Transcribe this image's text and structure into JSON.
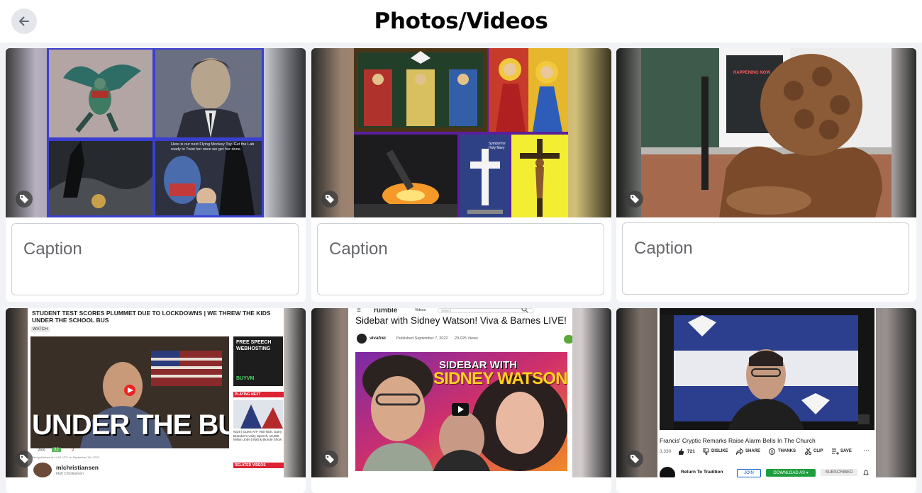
{
  "header": {
    "title": "Photos/Videos",
    "back_icon": "arrow-left-icon"
  },
  "captions": {
    "placeholder": "Caption"
  },
  "tag_icon": "tag-icon",
  "cards": {
    "card4": {
      "headline": "STUDENT TEST SCORES PLUMMET DUE TO LOCKDOWNS | WE THREW THE KIDS UNDER THE SCHOOL BUS",
      "watch": "WATCH",
      "overlay_text": "UNDER THE BUS",
      "ad_title": "FREE SPEECH WEBHOSTING",
      "ad_brand": "BUYVM",
      "playing_next": "PLAYING NEXT",
      "related": "RELATED VIDEOS",
      "side_text": "#226 | Guest ATF Visit Nick, Garry Brandon's Unity Speech, 10,000 Million Jobs | Matt & Blonde Show",
      "channel": "mlchristiansen",
      "channel_sub": "Matt Christiansen",
      "views": "293",
      "likes": "32",
      "dislikes": "2",
      "published": "First published at 14:51 UTC on September 7th, 2022."
    },
    "card5": {
      "brand": "rumble",
      "videos_tab": "Videos",
      "search_placeholder": "Search",
      "title": "Sidebar with Sidney Watson! Viva & Barnes LIVE!",
      "channel": "vivafrei",
      "meta": "Published September 7, 2022",
      "views": "29,025 Views",
      "thumb_line1": "SIDEBAR WITH",
      "thumb_line2": "SIDNEY WATSON"
    },
    "card6": {
      "title": "Francis' Cryptic Remarks Raise Alarm Bells In The Church",
      "views": "3,330",
      "likes": "721",
      "dislike": "DISLIKE",
      "share": "SHARE",
      "thanks": "THANKS",
      "clip": "CLIP",
      "save": "SAVE",
      "channel": "Return To Tradition",
      "join": "JOIN",
      "download": "DOWNLOAD AS ▾",
      "subscribed": "SUBSCRIBED"
    },
    "card1_caption_text": "Here is our next Flying Monkey Toy. Get the Lab ready to Twist her once we get her done.",
    "card2_sign": "Symbol for Holy Mary",
    "card3_sign": "HAPPENING NOW"
  }
}
